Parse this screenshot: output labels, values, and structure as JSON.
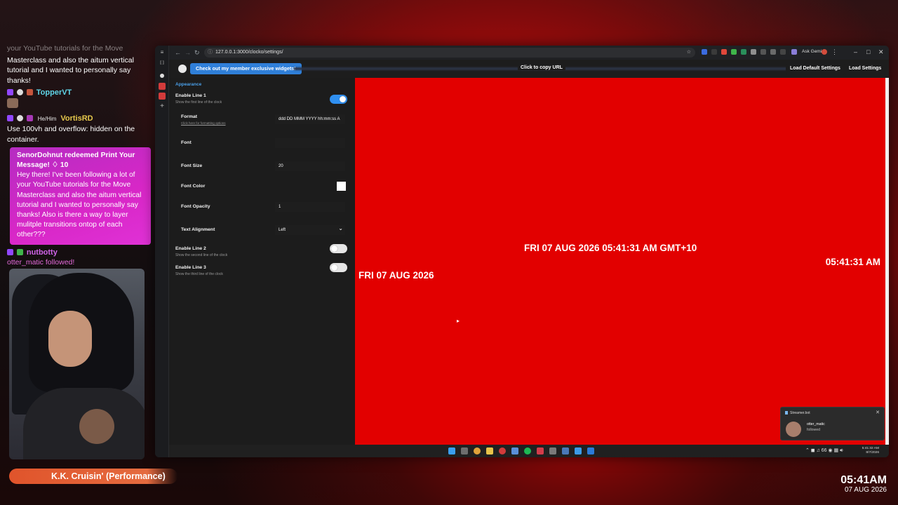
{
  "chat": {
    "top_fragment": "your YouTube tutorials for the Move",
    "top_continued": "Masterclass and also the aitum vertical tutorial and I wanted to personally say thanks!",
    "msg1": {
      "user": "TopperVT"
    },
    "msg2": {
      "pronouns": "He/Him",
      "user": "VortisRD",
      "text": "Use 100vh and overflow: hidden on the container."
    },
    "redemption": {
      "title": "SenorDohnut redeemed Print Your Message! ♢ 10",
      "body": "Hey there! I've been following a lot of your YouTube tutorials for the Move Masterclass and also the aitum vertical tutorial and I wanted to personally say thanks! Also is there a way to layer mulitple transitions ontop of each other???"
    },
    "msg3": {
      "user": "nutbotty"
    },
    "follow_event": "otter_matic followed!"
  },
  "now_playing": "K.K. Cruisin' (Performance)",
  "stream_clock": {
    "time": "05:41AM",
    "date": "07 AUG 2026"
  },
  "browser": {
    "url": "127.0.0.1:3000/clocko/settings/",
    "ask_gemini": "Ask Gemini"
  },
  "page": {
    "member_button": "Check out my member exclusive widgets!",
    "copy_url": "Click to copy URL",
    "load_default": "Load Default Settings",
    "load_settings": "Load Settings"
  },
  "settings": {
    "section": "Appearance",
    "enable_line1": {
      "label": "Enable Line 1",
      "desc": "Show the first line of the clock",
      "on": true
    },
    "format": {
      "label": "Format",
      "link": "Click here for formatting options",
      "value": "ddd DD MMM YYYY hh:mm:ss A"
    },
    "font": {
      "label": "Font",
      "value": ""
    },
    "font_size": {
      "label": "Font Size",
      "value": "20"
    },
    "font_color": {
      "label": "Font Color",
      "value": "#ffffff"
    },
    "font_opacity": {
      "label": "Font Opacity",
      "value": "1"
    },
    "text_alignment": {
      "label": "Text Alignment",
      "value": "Left"
    },
    "enable_line2": {
      "label": "Enable Line 2",
      "desc": "Show the second line of the clock",
      "on": false
    },
    "enable_line3": {
      "label": "Enable Line 3",
      "desc": "Show the third line of the clock",
      "on": false
    }
  },
  "preview": {
    "background": "#e20000",
    "center_text": "FRI 07 AUG 2026 05:41:31 AM GMT+10",
    "right_text": "05:41:31 AM",
    "left_text": "FRI 07 AUG 2026"
  },
  "taskbar": {
    "tray_temp": "66",
    "time": "5:41:32 AM",
    "date": "8/7/2026"
  },
  "notification": {
    "app": "Streamer.bot",
    "user": "otter_matic",
    "action": "followed"
  },
  "colors": {
    "accent_blue": "#2f8ff0",
    "redeem_pink": "#d827c7",
    "now_playing_orange": "#e0542b"
  }
}
